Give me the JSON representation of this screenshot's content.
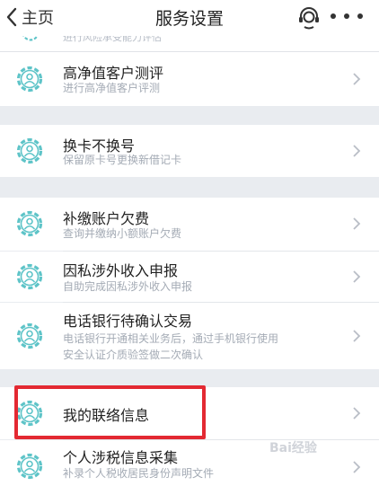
{
  "header": {
    "back_label": "主页",
    "title": "服务设置",
    "icons": [
      "chevron-left-icon",
      "customer-service-icon",
      "more-icon"
    ]
  },
  "partial_row": {
    "subtitle": "进行风险承受能力评估"
  },
  "items": [
    {
      "title": "高净值客户测评",
      "subtitle": "进行高净值客户评测"
    },
    {
      "title": "换卡不换号",
      "subtitle": "保留原卡号更换新借记卡"
    },
    {
      "title": "补缴账户欠费",
      "subtitle": "查询并缴纳小额账户欠费"
    },
    {
      "title": "因私涉外收入申报",
      "subtitle": "自助完成因私涉外收入申报"
    },
    {
      "title": "电话银行待确认交易",
      "subtitle_line1": "电话银行开通相关业务后，通过手机银行使用",
      "subtitle_line2": "安全认证介质验签做二次确认"
    },
    {
      "title": "我的联络信息"
    },
    {
      "title": "个人涉税信息采集",
      "subtitle": "补录个人税收居民身份声明文件"
    }
  ],
  "watermark": "Bai经验",
  "colors": {
    "icon_teal": "#5ec4c8",
    "highlight_red": "#e32932",
    "background": "#e9ecf0"
  }
}
